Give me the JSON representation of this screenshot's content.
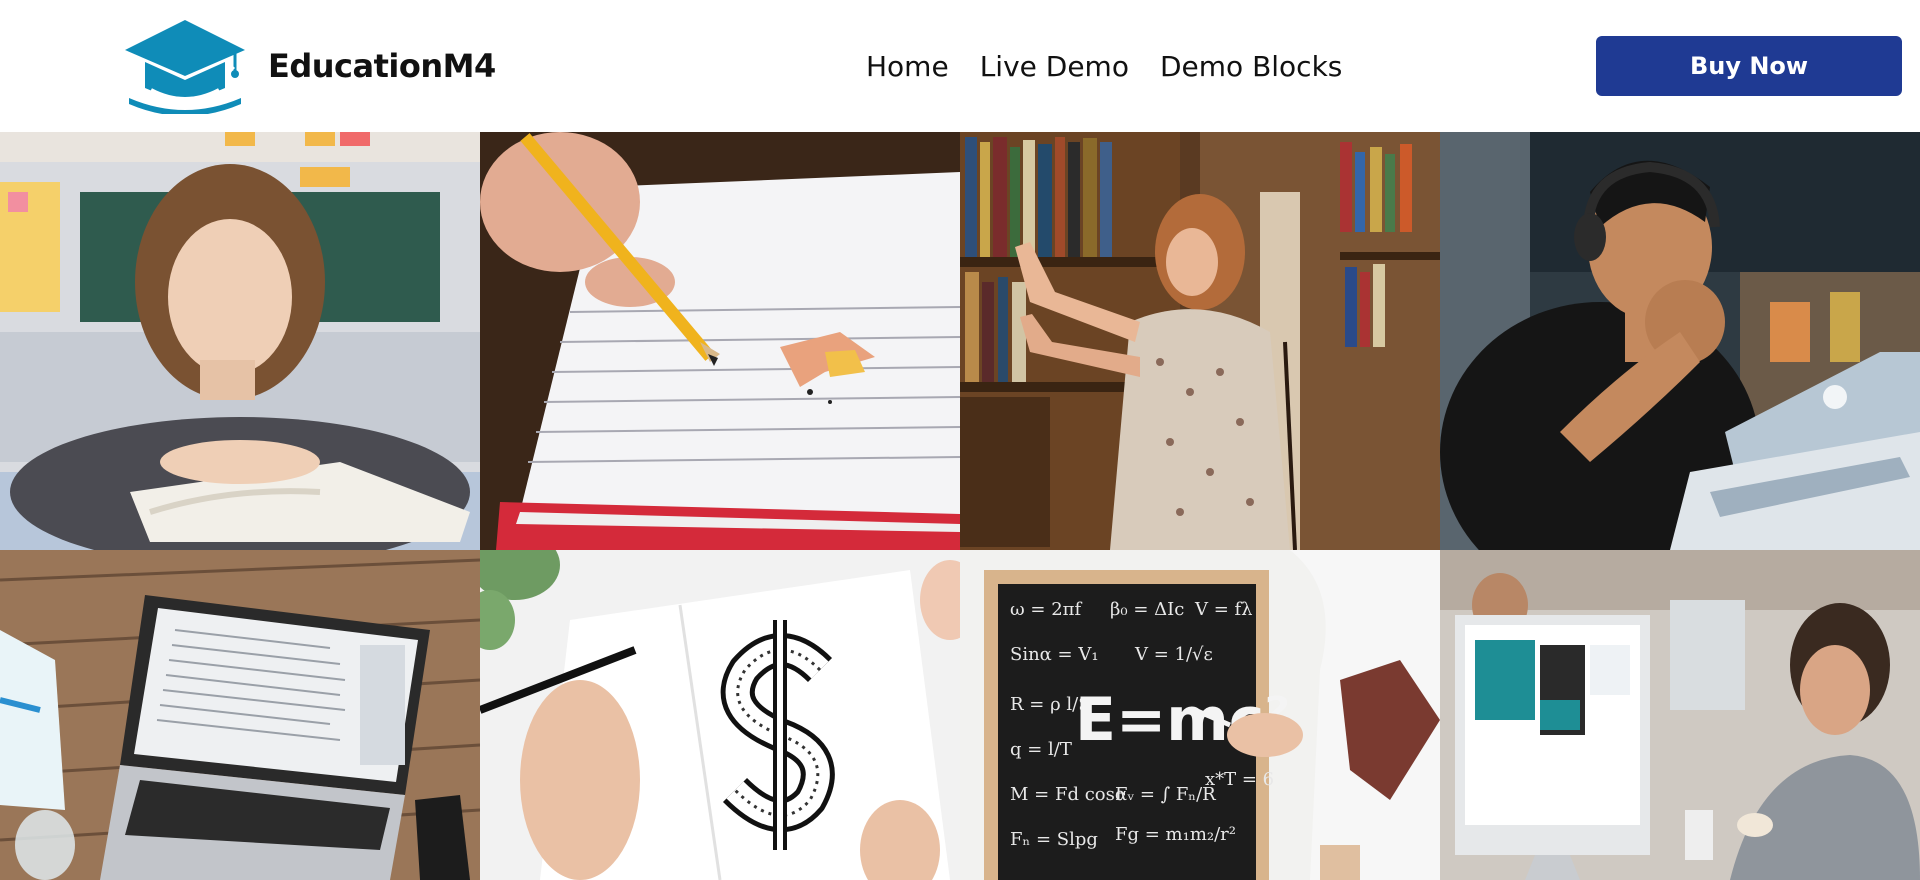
{
  "brand": {
    "name": "EducationM4",
    "logo_icon": "graduation-cap-icon",
    "logo_color": "#0f8cb8"
  },
  "nav": {
    "items": [
      "Home",
      "Live Demo",
      "Demo Blocks"
    ]
  },
  "cta": {
    "label": "Buy Now",
    "color": "#1f3a93"
  },
  "gallery": {
    "photos": [
      "student-resting-on-book-photo",
      "hand-writing-with-pencil-photo",
      "woman-browsing-library-shelves-photo",
      "man-with-headphones-at-laptop-photo",
      "laptop-on-wooden-desk-photo",
      "hand-drawing-dollar-sign-photo",
      "chalkboard-equations-photo",
      "man-working-at-computer-office-photo"
    ]
  }
}
